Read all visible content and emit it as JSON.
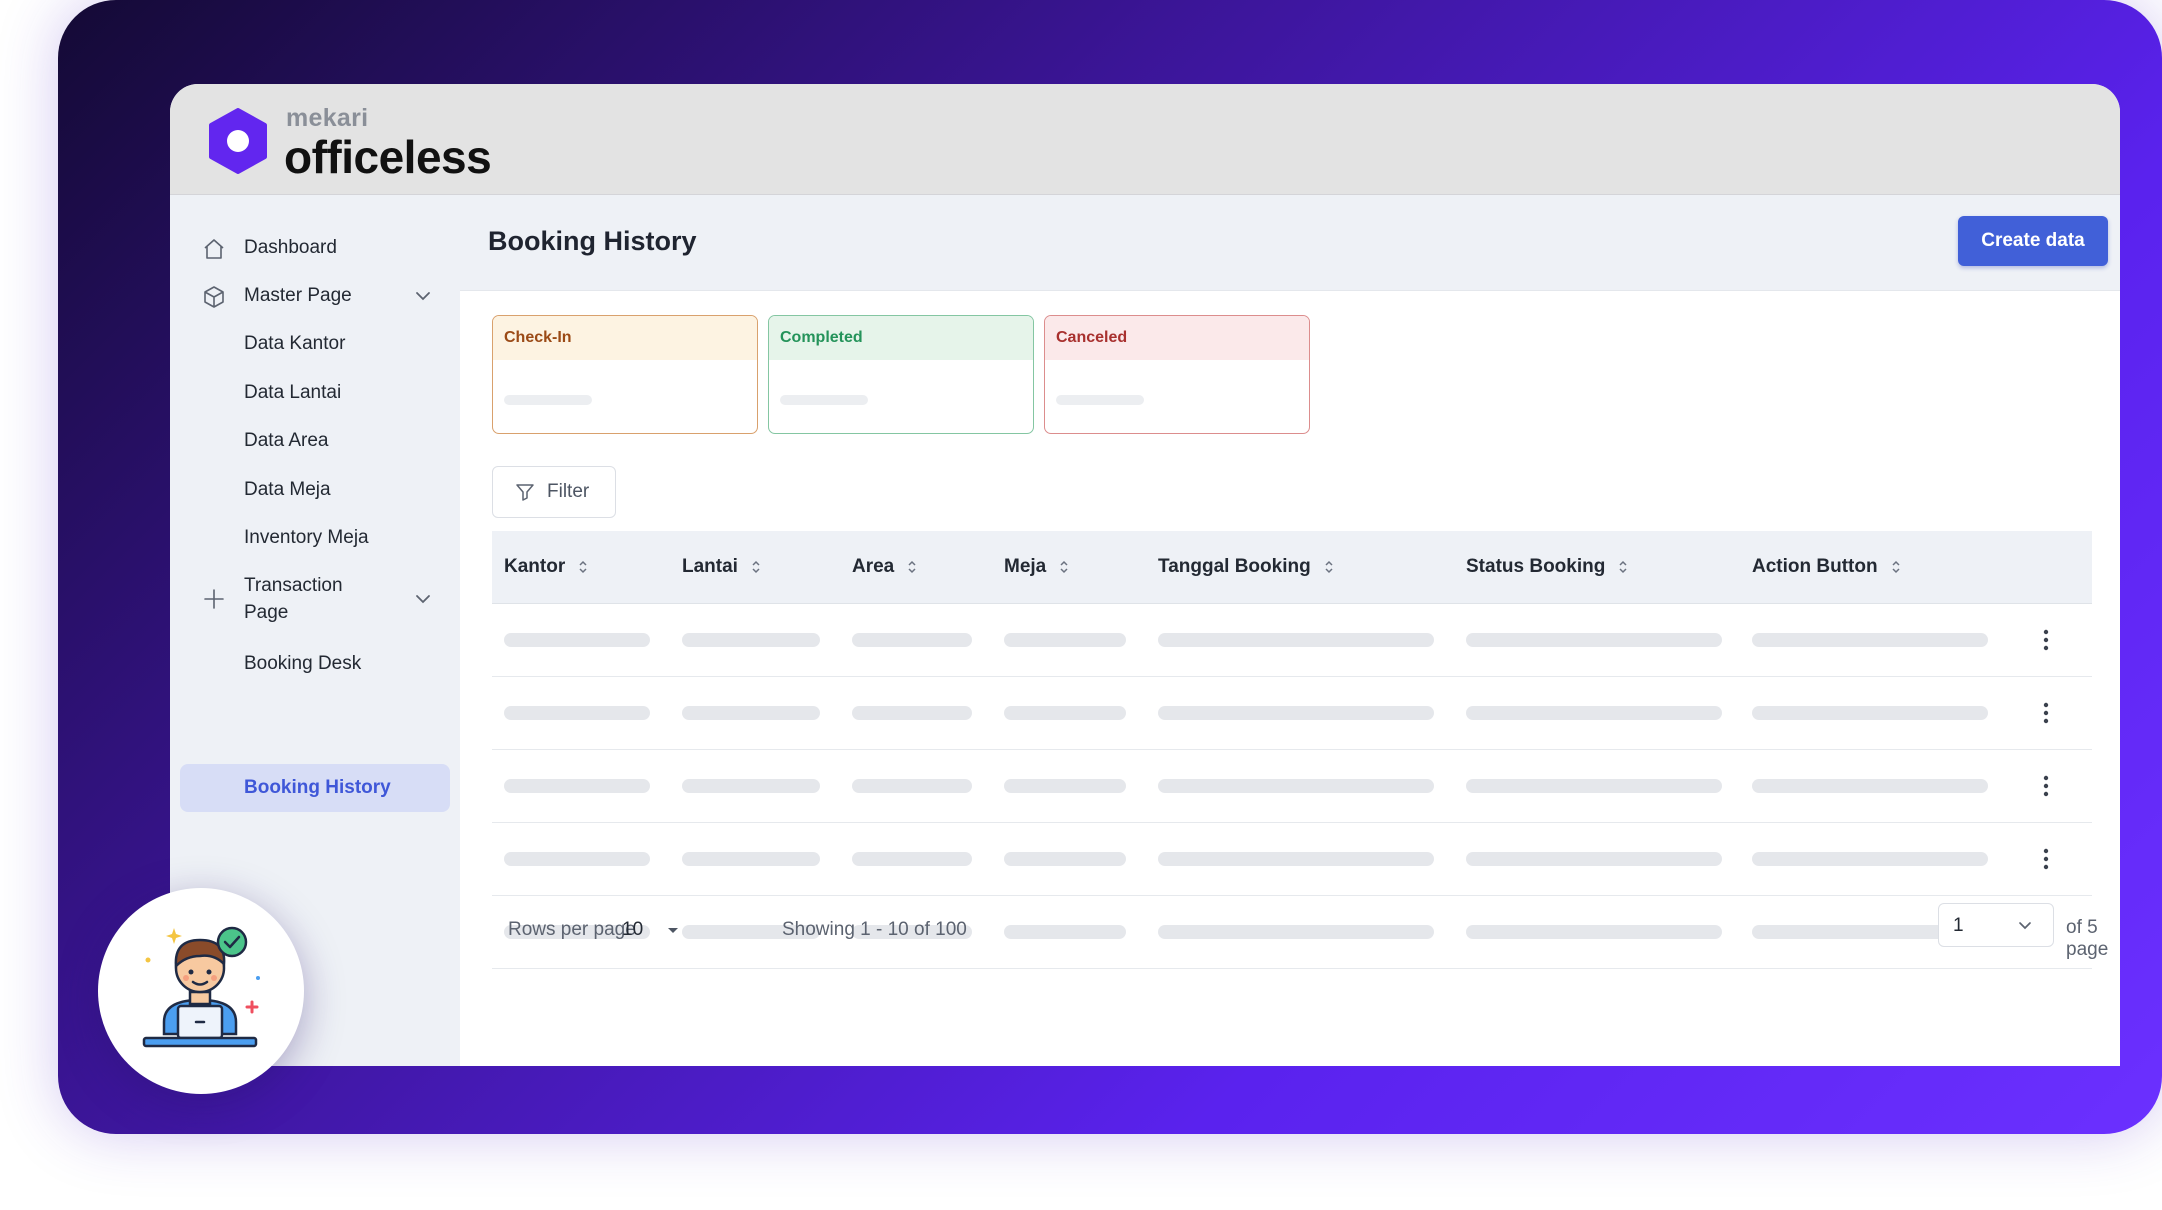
{
  "brand": {
    "sub": "mekari",
    "name": "officeless",
    "accent_color": "#6226ef"
  },
  "sidebar": {
    "items": [
      {
        "label": "Dashboard",
        "icon": "home-icon"
      },
      {
        "label": "Master Page",
        "icon": "cube-icon",
        "expanded": true
      },
      {
        "label": "Data Kantor"
      },
      {
        "label": "Data Lantai"
      },
      {
        "label": "Data Area"
      },
      {
        "label": "Data Meja"
      },
      {
        "label": "Inventory Meja"
      },
      {
        "label": "Transaction Page",
        "icon": "plus-icon",
        "expanded": true
      },
      {
        "label": "Booking Desk"
      },
      {
        "label": "Booking History",
        "active": true
      }
    ]
  },
  "main": {
    "title": "Booking History",
    "create_button": "Create data",
    "filter_button": "Filter",
    "status_cards": [
      {
        "label": "Check-In",
        "color": "#9b4a16"
      },
      {
        "label": "Completed",
        "color": "#24935a"
      },
      {
        "label": "Canceled",
        "color": "#a8302e"
      }
    ]
  },
  "table": {
    "columns": [
      "Kantor",
      "Lantai",
      "Area",
      "Meja",
      "Tanggal Booking",
      "Status Booking",
      "Action Button"
    ],
    "rows_loading": 5
  },
  "pagination": {
    "rows_per_page_label": "Rows per page",
    "rows_per_page_value": "10",
    "showing": "Showing 1 - 10 of 100",
    "current_page": "1",
    "of_pages": "of 5 page"
  },
  "colors": {
    "primary_button": "#4160d8",
    "active_nav_bg": "#d7ddf6",
    "frame_gradient_start": "#140a35",
    "frame_gradient_end": "#6b30ff"
  }
}
